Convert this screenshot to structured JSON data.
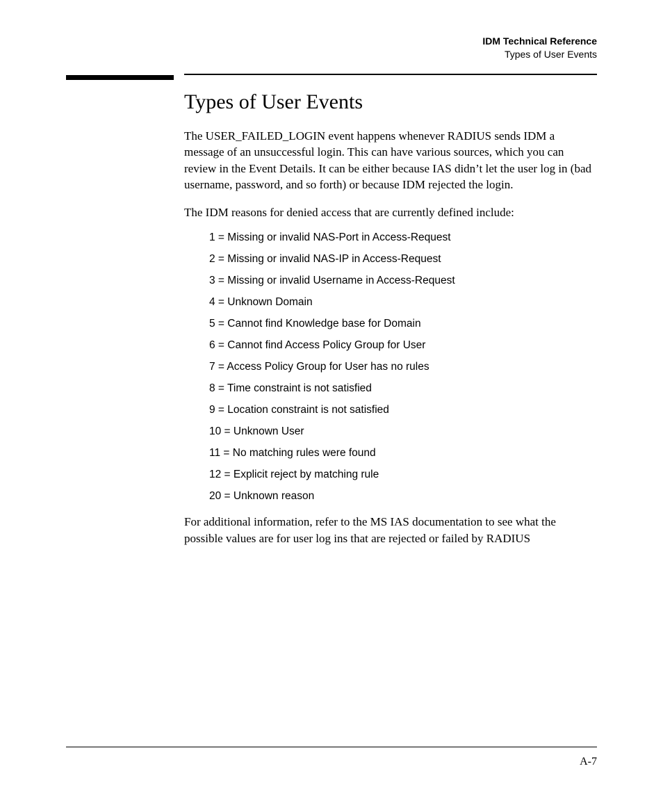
{
  "header": {
    "doc_title": "IDM Technical Reference",
    "section_label": "Types of User Events"
  },
  "section": {
    "title": "Types of User Events",
    "para1": "The USER_FAILED_LOGIN event happens whenever RADIUS sends IDM a message of an unsuccessful login. This can have various sources, which you can review in the Event Details. It can be either because IAS didn’t let the user log in (bad username, password, and so forth) or because IDM rejected the login.",
    "para2": "The IDM reasons for denied access that are currently defined include:",
    "reasons": [
      "1 = Missing or invalid NAS-Port in Access-Request",
      "2 = Missing or invalid NAS-IP in Access-Request",
      "3 = Missing or invalid Username in Access-Request",
      "4 = Unknown Domain",
      "5 = Cannot find Knowledge base for Domain",
      "6 = Cannot find Access Policy Group for User",
      "7 = Access Policy Group for User has no rules",
      "8 = Time constraint is not satisfied",
      "9 = Location constraint is not satisfied",
      "10 = Unknown User",
      "11 = No matching rules were found",
      "12 = Explicit reject by matching rule",
      "20 = Unknown reason"
    ],
    "para3": "For additional information, refer to the MS IAS documentation to see what the possible values are for user log ins that are rejected or failed by RADIUS"
  },
  "footer": {
    "page_number": "A-7"
  }
}
